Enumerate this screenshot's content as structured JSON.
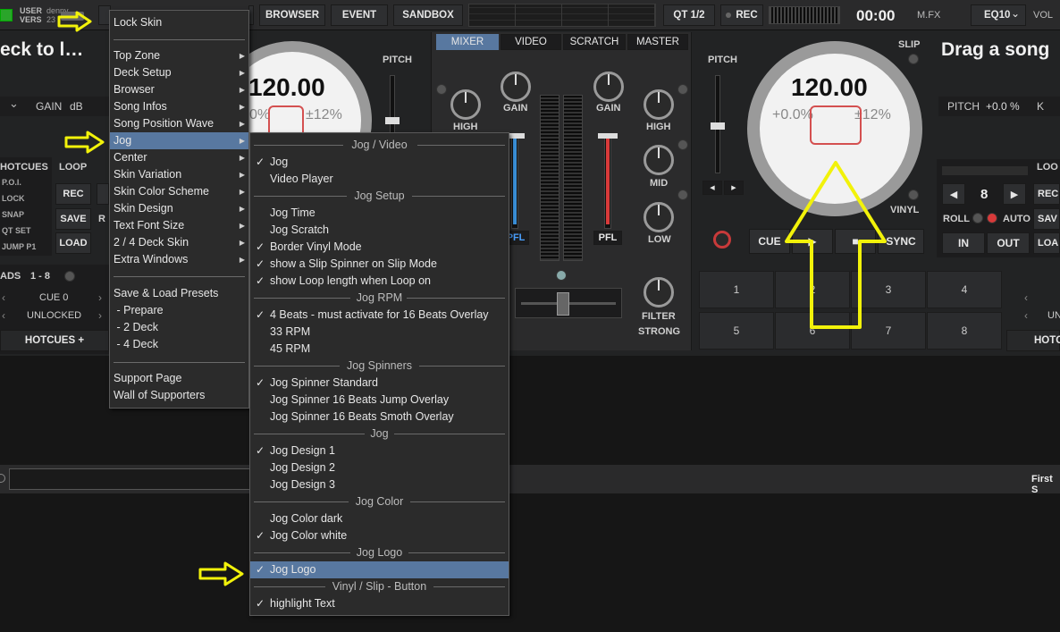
{
  "topbar": {
    "user_label": "USER",
    "user_value": "denny",
    "vers_label": "VERS",
    "vers_value": "23",
    "tabs": [
      "BROWSER",
      "EVENT",
      "SANDBOX"
    ],
    "qt_label": "QT 1/2",
    "rec_label": "REC",
    "time": "00:00",
    "mfx_label": "M.FX",
    "eq_label": "EQ10",
    "vol_label": "VOL"
  },
  "deck_left": {
    "title": "eck to l…",
    "bpm": "120.00",
    "pitch_pct": "0%",
    "range": "±12%",
    "gain_label": "GAIN",
    "gain_unit": "dB",
    "pitch_label": "PITCH",
    "side_labels": [
      "HOTCUES",
      "P.O.I.",
      "LOCK",
      "SNAP",
      "QT SET",
      "JUMP P1"
    ],
    "loop_label": "LOOP",
    "rec_label": "REC",
    "save_label": "SAVE",
    "load_label": "LOAD",
    "r_label": "R",
    "pads_label": "ADS",
    "pads_range": "1 - 8",
    "cue0": "CUE 0",
    "unlocked": "UNLOCKED",
    "hotcues_plus": "HOTCUES +"
  },
  "mixer": {
    "tabs": [
      "MIXER",
      "VIDEO",
      "SCRATCH",
      "MASTER"
    ],
    "gain_label": "GAIN",
    "high_label": "HIGH",
    "mid_label": "MID",
    "low_label": "LOW",
    "pfl_label": "PFL",
    "filter_label": "FILTER",
    "strong_label": "STRONG"
  },
  "deck_right": {
    "title": "Drag a song",
    "bpm": "120.00",
    "pitch_pct": "+0.0%",
    "range": "±12%",
    "slip_label": "SLIP",
    "vinyl_label": "VINYL",
    "pitch_label": "PITCH",
    "pitch_info_label": "PITCH",
    "pitch_info_value": "+0.0 %",
    "k_label": "K",
    "cue_label": "CUE",
    "sync_label": "SYNC",
    "loop_label": "LOO",
    "loop_value": "8",
    "roll_label": "ROLL",
    "auto_label": "AUTO",
    "in_label": "IN",
    "out_label": "OUT",
    "rec_label": "REC",
    "save_label": "SAV",
    "load_label": "LOA",
    "un_label": "UN",
    "hotcues_label": "HOTC",
    "pads": [
      "1",
      "2",
      "3",
      "4",
      "5",
      "6",
      "7",
      "8"
    ]
  },
  "browser": {
    "first_label": "First S"
  },
  "menu_main": {
    "items": [
      {
        "label": "Lock Skin",
        "arrow": false
      },
      {
        "label": "Top Zone",
        "arrow": true
      },
      {
        "label": "Deck Setup",
        "arrow": true
      },
      {
        "label": "Browser",
        "arrow": true
      },
      {
        "label": "Song Infos",
        "arrow": true
      },
      {
        "label": "Song Position Wave",
        "arrow": true
      },
      {
        "label": "Jog",
        "arrow": true
      },
      {
        "label": "Center",
        "arrow": true
      },
      {
        "label": "Skin Variation",
        "arrow": true
      },
      {
        "label": "Skin Color Scheme",
        "arrow": true
      },
      {
        "label": "Skin Design",
        "arrow": true
      },
      {
        "label": "Text Font Size",
        "arrow": true
      },
      {
        "label": "2 / 4 Deck Skin",
        "arrow": true
      },
      {
        "label": "Extra Windows",
        "arrow": true
      },
      {
        "label": "Save & Load Presets",
        "arrow": false
      },
      {
        "label": " - Prepare",
        "arrow": false
      },
      {
        "label": " - 2 Deck",
        "arrow": false
      },
      {
        "label": " - 4 Deck",
        "arrow": false
      },
      {
        "label": "Support Page",
        "arrow": false
      },
      {
        "label": "Wall of Supporters",
        "arrow": false
      }
    ]
  },
  "menu_jog": {
    "headers": [
      "Jog / Video",
      "Jog Setup",
      "Jog RPM",
      "Jog Spinners",
      "Jog",
      "Jog Color",
      "Jog Logo",
      "Vinyl / Slip - Button"
    ],
    "items": [
      {
        "label": "Jog",
        "checked": true
      },
      {
        "label": "Video Player",
        "checked": false
      },
      {
        "label": "Jog Time",
        "checked": false
      },
      {
        "label": "Jog Scratch",
        "checked": false
      },
      {
        "label": "Border Vinyl Mode",
        "checked": true
      },
      {
        "label": "show a Slip Spinner on Slip Mode",
        "checked": true
      },
      {
        "label": "show Loop length when Loop on",
        "checked": true
      },
      {
        "label": "4 Beats - must activate for 16 Beats Overlay",
        "checked": true
      },
      {
        "label": "33 RPM",
        "checked": false
      },
      {
        "label": "45 RPM",
        "checked": false
      },
      {
        "label": "Jog Spinner Standard",
        "checked": true
      },
      {
        "label": "Jog Spinner 16 Beats Jump Overlay",
        "checked": false
      },
      {
        "label": "Jog Spinner 16 Beats Smoth Overlay",
        "checked": false
      },
      {
        "label": "Jog Design 1",
        "checked": true
      },
      {
        "label": "Jog Design 2",
        "checked": false
      },
      {
        "label": "Jog Design 3",
        "checked": false
      },
      {
        "label": "Jog Color dark",
        "checked": false
      },
      {
        "label": "Jog Color white",
        "checked": true
      },
      {
        "label": "Jog Logo",
        "checked": true
      },
      {
        "label": "highlight Text",
        "checked": true
      }
    ]
  },
  "colors": {
    "accent_blue": "#5878a0",
    "arrow_yellow": "#f2f20a",
    "pfl_blue": "#3a8fd8",
    "pfl_red": "#d83a3a"
  },
  "icons": {
    "check": "✓",
    "submenu": "▶",
    "play": "▶",
    "stop": "■",
    "prev": "◀",
    "next": "▶",
    "chev_down": "⌄"
  }
}
